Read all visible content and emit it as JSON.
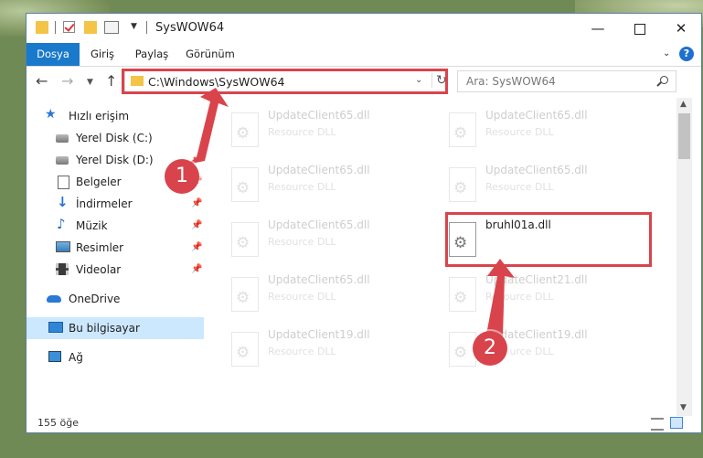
{
  "window": {
    "title": "SysWOW64"
  },
  "ribbon": {
    "tabs": [
      "Dosya",
      "Giriş",
      "Paylaş",
      "Görünüm"
    ]
  },
  "address": {
    "path": "C:\\Windows\\SysWOW64",
    "search_placeholder": "Ara: SysWOW64"
  },
  "sidebar": {
    "items": [
      {
        "label": "Hızlı erişim",
        "icon": "star-icon"
      },
      {
        "label": "Yerel Disk (C:)",
        "icon": "disk-icon"
      },
      {
        "label": "Yerel Disk (D:)",
        "icon": "disk-icon"
      },
      {
        "label": "Belgeler",
        "icon": "documents-icon"
      },
      {
        "label": "İndirmeler",
        "icon": "download-icon"
      },
      {
        "label": "Müzik",
        "icon": "music-icon"
      },
      {
        "label": "Resimler",
        "icon": "pictures-icon"
      },
      {
        "label": "Videolar",
        "icon": "videos-icon"
      },
      {
        "label": "OneDrive",
        "icon": "cloud-icon"
      },
      {
        "label": "Bu bilgisayar",
        "icon": "computer-icon",
        "selected": true
      },
      {
        "label": "Ağ",
        "icon": "network-icon"
      }
    ]
  },
  "files": [
    {
      "name": "UpdateClient65.dll",
      "type": "Resource DLL",
      "faded": true
    },
    {
      "name": "UpdateClient65.dll",
      "type": "Resource DLL",
      "faded": true
    },
    {
      "name": "UpdateClient65.dll",
      "type": "Resource DLL",
      "faded": true
    },
    {
      "name": "UpdateClient65.dll",
      "type": "Resource DLL",
      "faded": true
    },
    {
      "name": "UpdateClient65.dll",
      "type": "Resource DLL",
      "faded": true
    },
    {
      "name": "bruhl01a.dll",
      "type": "",
      "faded": false
    },
    {
      "name": "UpdateClient65.dll",
      "type": "Resource DLL",
      "faded": true
    },
    {
      "name": "UpdateClient21.dll",
      "type": "Resource DLL",
      "faded": true
    },
    {
      "name": "UpdateClient19.dll",
      "type": "Resource DLL",
      "faded": true
    },
    {
      "name": "UpdateClient19.dll",
      "type": "Resource DLL",
      "faded": true
    }
  ],
  "status": {
    "item_count": "155 öğe"
  },
  "annotations": {
    "step1": "1",
    "step2": "2",
    "color": "#d9444c"
  }
}
